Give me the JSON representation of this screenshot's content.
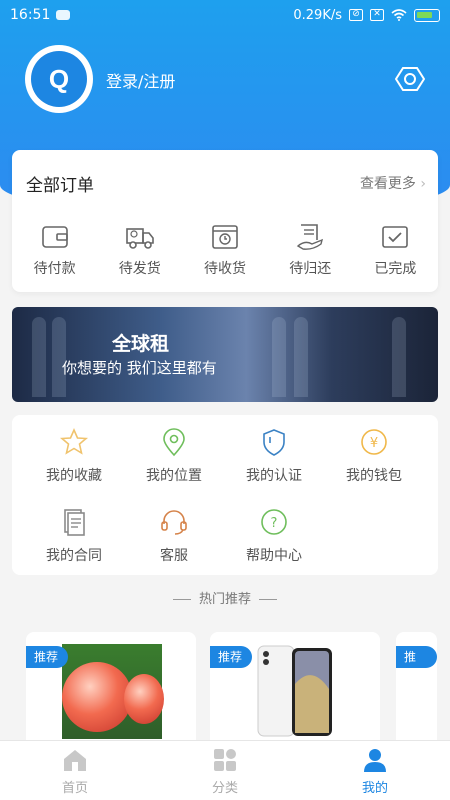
{
  "status_bar": {
    "time": "16:51",
    "speed": "0.29K/s"
  },
  "header": {
    "login_label": "登录/注册"
  },
  "orders": {
    "title": "全部订单",
    "more": "查看更多",
    "items": [
      {
        "label": "待付款",
        "icon": "wallet-icon"
      },
      {
        "label": "待发货",
        "icon": "truck-icon"
      },
      {
        "label": "待收货",
        "icon": "box-clock-icon"
      },
      {
        "label": "待归还",
        "icon": "return-icon"
      },
      {
        "label": "已完成",
        "icon": "check-icon"
      }
    ]
  },
  "banner": {
    "title": "全球租",
    "subtitle": "你想要的 我们这里都有"
  },
  "services": [
    {
      "label": "我的收藏",
      "icon": "star-icon",
      "color": "#f0c36d"
    },
    {
      "label": "我的位置",
      "icon": "location-icon",
      "color": "#6fbe5c"
    },
    {
      "label": "我的认证",
      "icon": "shield-icon",
      "color": "#3b82c4"
    },
    {
      "label": "我的钱包",
      "icon": "wallet-yen-icon",
      "color": "#f0b84a"
    },
    {
      "label": "我的合同",
      "icon": "contract-icon",
      "color": "#8a8a8a"
    },
    {
      "label": "客服",
      "icon": "headset-icon",
      "color": "#d5834a"
    },
    {
      "label": "帮助中心",
      "icon": "help-icon",
      "color": "#6fbe5c"
    }
  ],
  "hot": {
    "title": "热门推荐"
  },
  "products": [
    {
      "tag": "推荐"
    },
    {
      "tag": "推荐"
    },
    {
      "tag": "推荐"
    }
  ],
  "tabbar": [
    {
      "label": "首页",
      "icon": "home-icon"
    },
    {
      "label": "分类",
      "icon": "category-icon"
    },
    {
      "label": "我的",
      "icon": "user-icon",
      "active": true
    }
  ],
  "colors": {
    "primary": "#1d86e2",
    "header_gradient": "#1ea0ee"
  }
}
